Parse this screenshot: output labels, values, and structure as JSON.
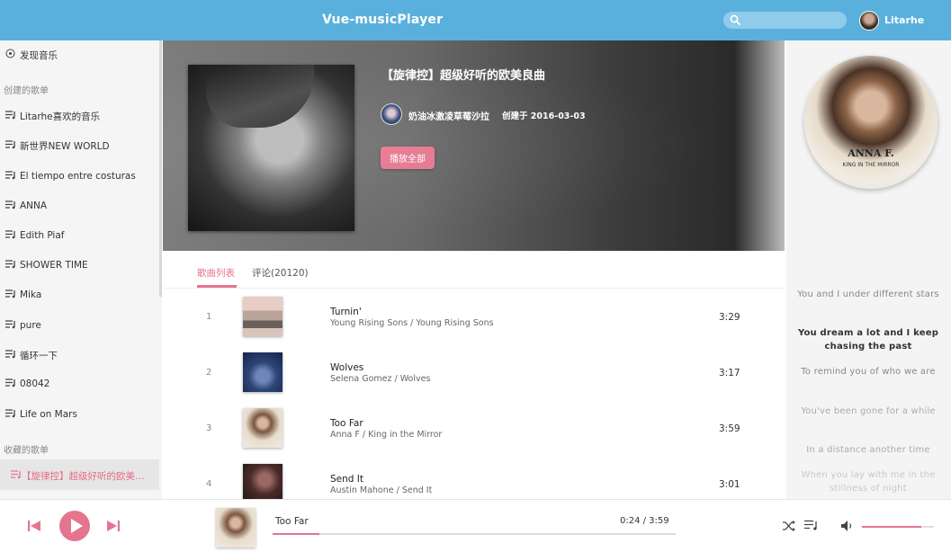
{
  "header": {
    "title": "Vue-musicPlayer",
    "search_placeholder": "",
    "username": "Litarhe"
  },
  "sidebar": {
    "discover": "发现音乐",
    "created_heading": "创建的歌单",
    "created": [
      "Litarhe喜欢的音乐",
      "新世界NEW WORLD",
      "El tiempo entre costuras",
      "ANNA",
      "Edith Piaf",
      "SHOWER TIME",
      "Mika",
      "pure",
      "循环一下",
      "08042",
      "Life on Mars"
    ],
    "collected_heading": "收藏的歌单",
    "collected": [
      "【旋律控】超级好听的欧美…"
    ]
  },
  "playlist": {
    "title": "【旋律控】超级好听的欧美良曲",
    "creator": "奶油冰激凌草莓沙拉",
    "created_at": "创建于 2016-03-03",
    "play_all": "播放全部"
  },
  "tabs": {
    "songs": "歌曲列表",
    "comments": "评论(20120)"
  },
  "songs": [
    {
      "idx": "1",
      "name": "Turnin'",
      "meta": "Young Rising Sons / Young Rising Sons",
      "duration": "3:29"
    },
    {
      "idx": "2",
      "name": "Wolves",
      "meta": "Selena Gomez / Wolves",
      "duration": "3:17"
    },
    {
      "idx": "3",
      "name": "Too Far",
      "meta": "Anna F / King in the Mirror",
      "duration": "3:59"
    },
    {
      "idx": "4",
      "name": "Send It",
      "meta": "Austin Mahone / Send It",
      "duration": "3:01"
    }
  ],
  "now_playing": {
    "disc_artist": "ANNA F.",
    "disc_album": "KING IN THE MIRROR",
    "title": "Too Far",
    "time": "0:24 / 3:59",
    "progress_fraction": 0.117,
    "volume_fraction": 0.82
  },
  "lyrics": [
    "You and I under different stars",
    "You dream a lot and I keep chasing the past",
    "To remind you of who we are",
    "You've been gone for a while",
    "In a distance another time",
    "When you lay with me in the stillness of night"
  ],
  "colors": {
    "header": "#5ab0dc",
    "accent": "#e5758e"
  }
}
